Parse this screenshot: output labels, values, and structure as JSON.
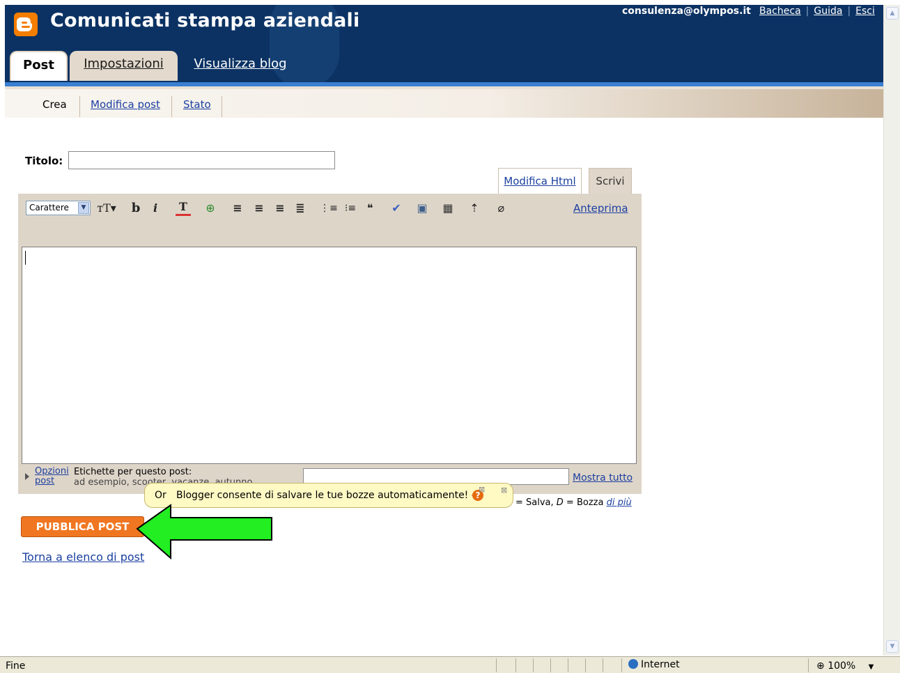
{
  "header": {
    "blog_title": "Comunicati stampa aziendali",
    "user_email": "consulenza@olympos.it",
    "links": [
      "Bacheca",
      "Guida",
      "Esci"
    ],
    "tabs": [
      {
        "label": "Post",
        "active": true
      },
      {
        "label": "Impostazioni",
        "active": false
      },
      {
        "label": "Visualizza blog",
        "active": false
      }
    ]
  },
  "subnav": {
    "items": [
      {
        "label": "Crea",
        "active": true
      },
      {
        "label": "Modifica post",
        "active": false
      },
      {
        "label": "Stato",
        "active": false
      }
    ]
  },
  "form": {
    "title_label": "Titolo:",
    "title_value": "",
    "mode_tabs": [
      "Modifica Html",
      "Scrivi"
    ],
    "active_mode": "Scrivi"
  },
  "toolbar": {
    "font_select_value": "Carattere",
    "buttons": [
      {
        "name": "font-size-icon",
        "glyph": "тT▾"
      },
      {
        "name": "bold-icon",
        "glyph": "b"
      },
      {
        "name": "italic-icon",
        "glyph": "i"
      },
      {
        "name": "text-color-icon",
        "glyph": "T"
      },
      {
        "name": "link-icon",
        "glyph": "⊕"
      },
      {
        "name": "align-left-icon",
        "glyph": "≡"
      },
      {
        "name": "align-center-icon",
        "glyph": "≡"
      },
      {
        "name": "align-right-icon",
        "glyph": "≡"
      },
      {
        "name": "align-justify-icon",
        "glyph": "≣"
      },
      {
        "name": "numbered-list-icon",
        "glyph": "⋮≡"
      },
      {
        "name": "bulleted-list-icon",
        "glyph": "⁝≡"
      },
      {
        "name": "blockquote-icon",
        "glyph": "❝"
      },
      {
        "name": "spellcheck-icon",
        "glyph": "✔"
      },
      {
        "name": "image-icon",
        "glyph": "▣"
      },
      {
        "name": "video-icon",
        "glyph": "▦"
      },
      {
        "name": "jump-break-icon",
        "glyph": "⇡"
      },
      {
        "name": "remove-format-icon",
        "glyph": "⌀"
      }
    ],
    "preview_label": "Anteprima"
  },
  "post_options": {
    "link_label": "Opzioni post",
    "labels_title": "Etichette per questo post:",
    "labels_example": "ad esempio, scooter, vacanze, autunno",
    "labels_value": "",
    "show_all_label": "Mostra tutto"
  },
  "tooltip": {
    "prefix": "Or",
    "message": "Blogger consente di salvare le tue bozze automaticamente! –"
  },
  "shortcuts": {
    "text": "= Salva, ",
    "key": "D",
    "rest": " = Bozza ",
    "more_link": "di più"
  },
  "actions": {
    "publish_label": "PUBBLICA POST",
    "back_label": "Torna a elenco di post"
  },
  "statusbar": {
    "status": "Fine",
    "zone": "Internet",
    "zoom": "100%"
  },
  "colors": {
    "header_bg": "#0b3263",
    "accent_blue": "#3a7fd1",
    "publish_orange": "#f07621",
    "arrow_green": "#22ee22",
    "tooltip_bg": "#fff9c4"
  }
}
